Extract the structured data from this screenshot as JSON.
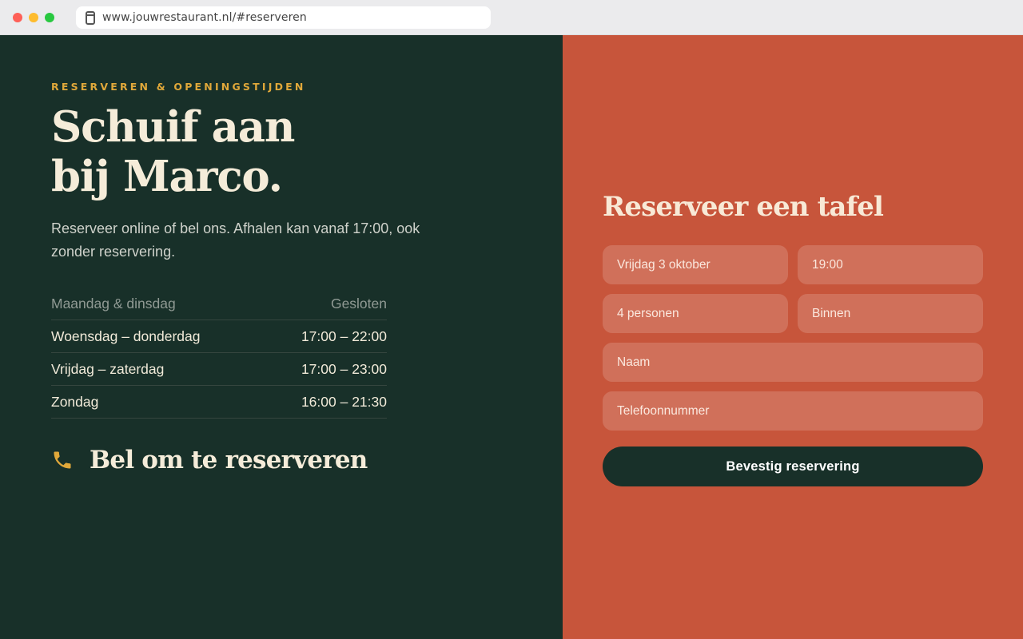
{
  "browser": {
    "url": "www.jouwrestaurant.nl/#reserveren"
  },
  "left": {
    "eyebrow": "RESERVEREN & OPENINGSTIJDEN",
    "headline_line1": "Schuif aan",
    "headline_line2": "bij Marco.",
    "intro": "Reserveer online of bel ons. Afhalen kan vanaf 17:00, ook zonder reservering.",
    "hours": [
      {
        "day": "Maandag & dinsdag",
        "time": "Gesloten"
      },
      {
        "day": "Woensdag – donderdag",
        "time": "17:00 – 22:00"
      },
      {
        "day": "Vrijdag – zaterdag",
        "time": "17:00 – 23:00"
      },
      {
        "day": "Zondag",
        "time": "16:00 – 21:30"
      }
    ],
    "phone_cta": "Bel om te reserveren",
    "phone_icon": "phone-icon"
  },
  "form": {
    "title": "Reserveer een tafel",
    "date_value": "Vrijdag 3 oktober",
    "time_value": "19:00",
    "guests_value": "4 personen",
    "seating_value": "Binnen",
    "name_placeholder": "Naam",
    "phone_placeholder": "Telefoonnummer",
    "submit_label": "Bevestig reservering"
  },
  "colors": {
    "left_bg": "#183029",
    "right_bg": "#c7553b",
    "accent": "#e0a83a",
    "cream": "#f5ecd9"
  }
}
